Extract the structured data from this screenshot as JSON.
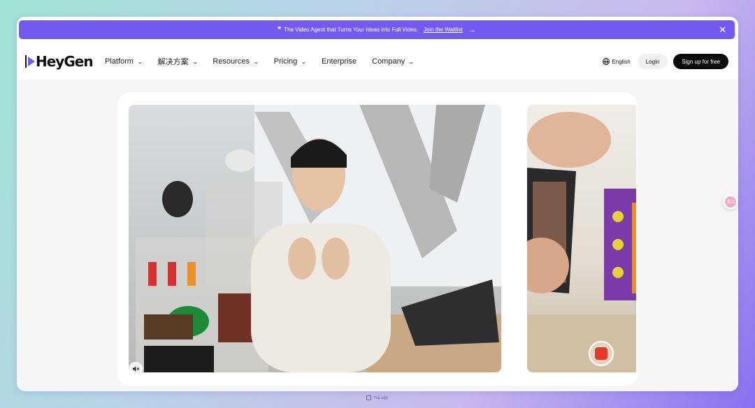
{
  "banner": {
    "quote_icon": "quote-icon",
    "message": "The Video Agent that Turns Your Ideas into Full Video.",
    "link": "Join the Waitlist",
    "arrow": "→",
    "close": "✕"
  },
  "nav": {
    "logo": "HeyGen",
    "menu": [
      {
        "label": "Platform",
        "has_dropdown": true
      },
      {
        "label": "解决方案",
        "has_dropdown": true
      },
      {
        "label": "Resources",
        "has_dropdown": true
      },
      {
        "label": "Pricing",
        "has_dropdown": true
      },
      {
        "label": "Enterprise",
        "has_dropdown": false
      },
      {
        "label": "Company",
        "has_dropdown": true
      }
    ],
    "language": "English",
    "login": "Login",
    "signup": "Sign up for free"
  },
  "media": {
    "mute_icon": "🔇",
    "main_video": "presenter-video",
    "side_video": "phone-recording-video",
    "record_color": "#e63b2b"
  },
  "floating": {
    "translate_icon": "文A"
  },
  "watermark": {
    "text": "Yuji.app"
  },
  "colors": {
    "accent": "#7559f5",
    "signup_bg": "#0b0b0b"
  }
}
